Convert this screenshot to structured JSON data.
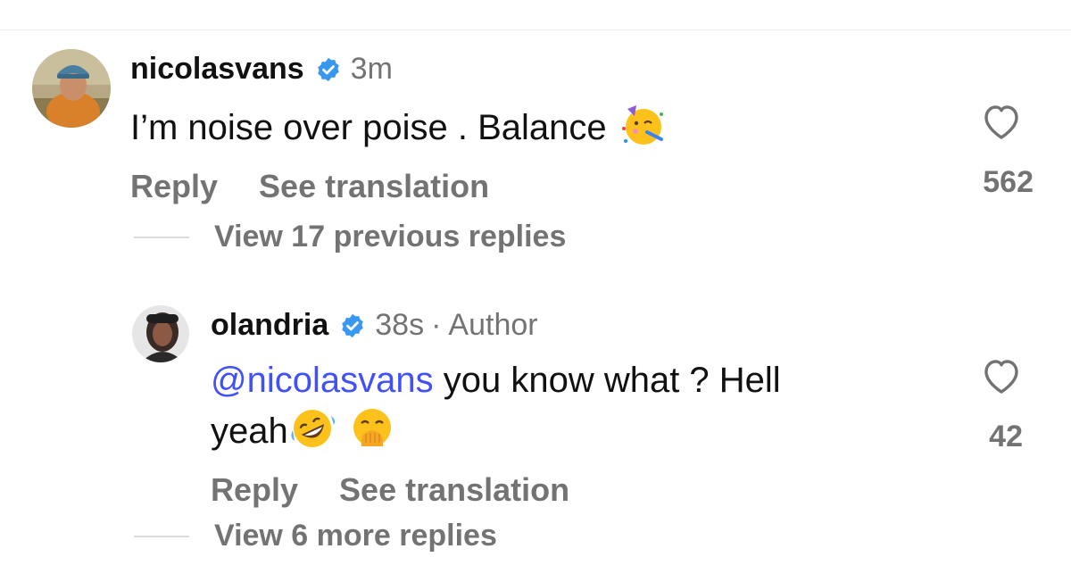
{
  "comments": [
    {
      "username": "nicolasvans",
      "time": "3m",
      "text": "I’m noise over poise . Balance",
      "emoji_icon": "partying-face-emoji",
      "reply_label": "Reply",
      "translate_label": "See translation",
      "like_count": "562",
      "view_replies_label": "View 17 previous replies"
    },
    {
      "username": "olandria",
      "time": "38s",
      "separator": "·",
      "author_badge": "Author",
      "mention": "@nicolasvans",
      "text_line1": " you know what ? Hell",
      "text_line2": "yeah",
      "emoji_icons": [
        "rolling-on-floor-laughing-emoji",
        "face-with-hand-over-mouth-emoji"
      ],
      "reply_label": "Reply",
      "translate_label": "See translation",
      "like_count": "42",
      "view_replies_label": "View 6 more replies"
    }
  ],
  "colors": {
    "verified_badge": "#3897f0",
    "mention": "#4150f7",
    "secondary_text": "#737373"
  }
}
